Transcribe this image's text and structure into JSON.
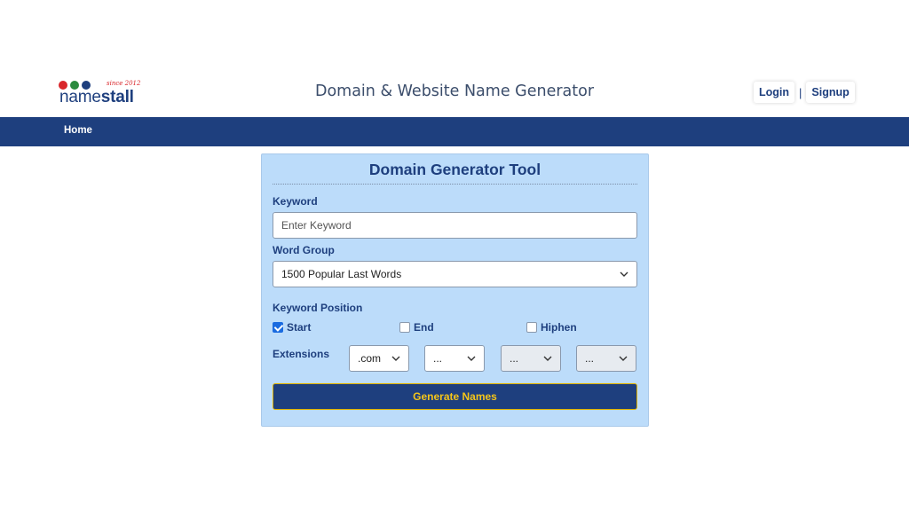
{
  "header": {
    "logo": {
      "since": "since 2012",
      "word_light": "name",
      "word_bold": "stall",
      "dot_colors": [
        "#d9262b",
        "#2a8a3e",
        "#1e3f7e"
      ]
    },
    "title": "Domain & Website Name Generator",
    "login_label": "Login",
    "separator": "|",
    "signup_label": "Signup"
  },
  "nav": {
    "items": [
      {
        "label": "Home"
      }
    ]
  },
  "tool": {
    "title": "Domain Generator Tool",
    "keyword": {
      "label": "Keyword",
      "placeholder": "Enter Keyword"
    },
    "word_group": {
      "label": "Word Group",
      "selected": "1500 Popular Last Words"
    },
    "position": {
      "label": "Keyword Position",
      "options": [
        {
          "label": "Start",
          "checked": true
        },
        {
          "label": "End",
          "checked": false
        },
        {
          "label": "Hiphen",
          "checked": false
        }
      ]
    },
    "extensions": {
      "label": "Extensions",
      "selects": [
        ".com",
        "...",
        "...",
        "..."
      ]
    },
    "generate_label": "Generate Names"
  },
  "colors": {
    "brand": "#1e3f7e",
    "card_bg": "#bcdcfa",
    "button_text": "#f5c518",
    "checkbox": "#1a6be0"
  }
}
